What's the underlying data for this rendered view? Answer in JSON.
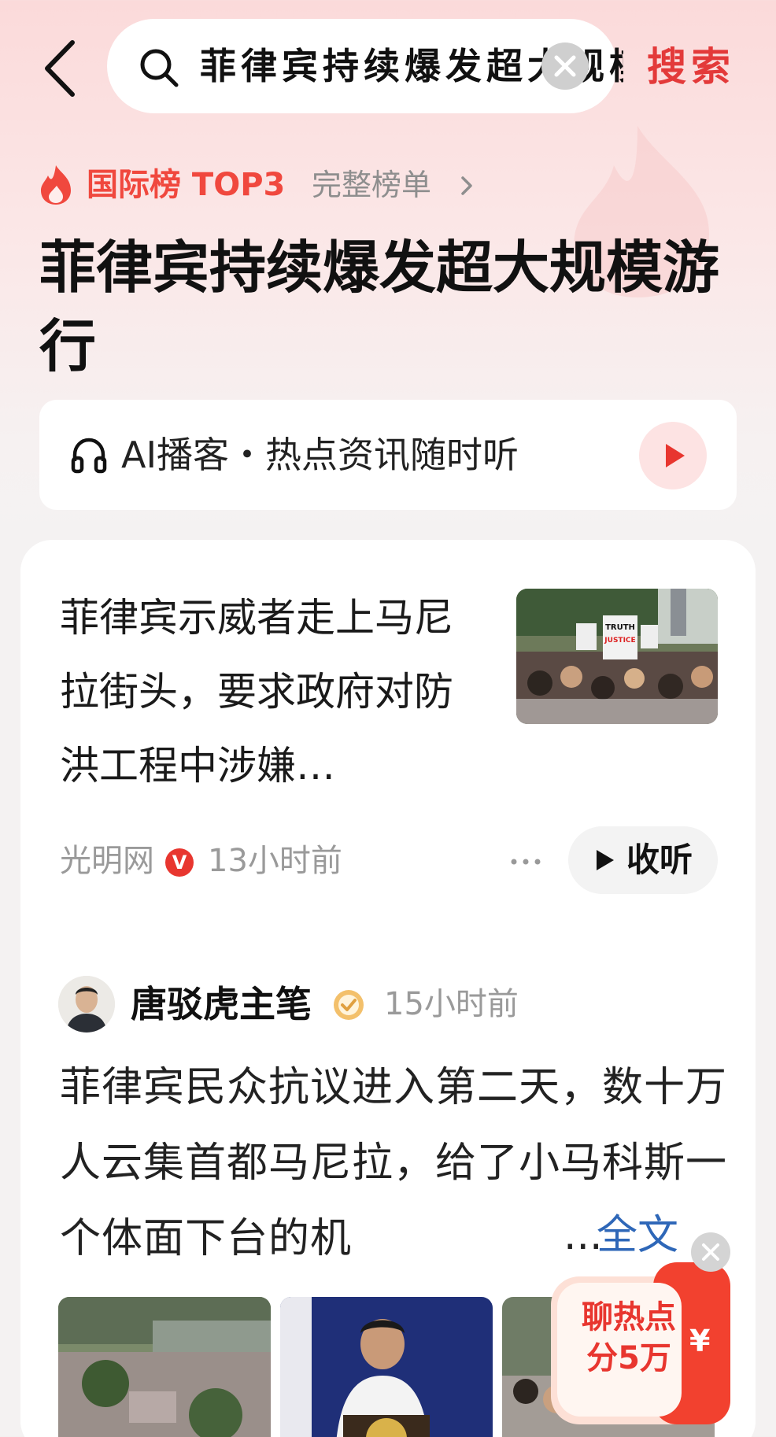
{
  "header": {
    "search_query": "菲律宾持续爆发超大规模游行",
    "search_button": "搜索"
  },
  "hotlist": {
    "rank_label": "国际榜 TOP3",
    "full_list_label": "完整榜单"
  },
  "page_title": "菲律宾持续爆发超大规模游行",
  "podcast": {
    "label": "AI播客・热点资讯随时听"
  },
  "news": {
    "title": "菲律宾示威者走上马尼拉街头，要求政府对防洪工程中涉嫌…",
    "source": "光明网",
    "verified_mark": "V",
    "time": "13小时前",
    "listen_label": "收听",
    "thumb_sign_1": "TRUTH",
    "thumb_sign_2": "JUSTICE"
  },
  "post": {
    "author": "唐驳虎主笔",
    "time": "15小时前",
    "text": "菲律宾民众抗议进入第二天，数十万人云集首都马尼拉，给了小马科斯一个体面下台的机",
    "ellipsis": "...",
    "full_text_label": "全文"
  },
  "promo": {
    "line1": "聊热点",
    "line2": "分5万",
    "currency": "¥"
  },
  "colors": {
    "accent_red": "#e8362f",
    "link_blue": "#2e67b8",
    "muted_gray": "#9a9a9a"
  }
}
